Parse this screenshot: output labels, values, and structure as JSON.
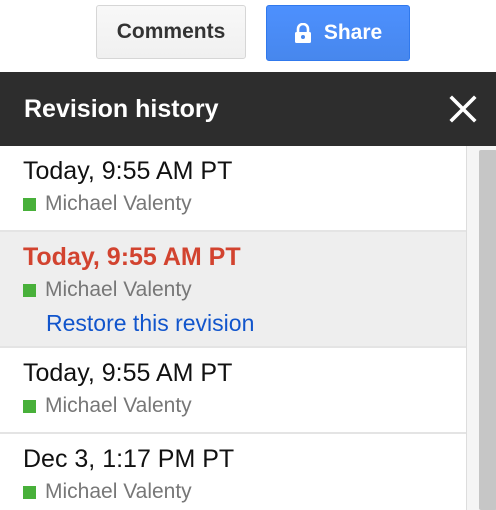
{
  "toolbar": {
    "comments_label": "Comments",
    "share_label": "Share"
  },
  "panel": {
    "title": "Revision history"
  },
  "revisions": [
    {
      "date": "Today, 9:55 AM PT",
      "author": "Michael Valenty",
      "author_color": "#48b03a",
      "selected": false
    },
    {
      "date": "Today, 9:55 AM PT",
      "author": "Michael Valenty",
      "author_color": "#48b03a",
      "selected": true,
      "action_label": "Restore this revision"
    },
    {
      "date": "Today, 9:55 AM PT",
      "author": "Michael Valenty",
      "author_color": "#48b03a",
      "selected": false
    },
    {
      "date": "Dec 3, 1:17 PM PT",
      "author": "Michael Valenty",
      "author_color": "#48b03a",
      "selected": false
    }
  ],
  "colors": {
    "share_button": "#4d90fe",
    "header_bg": "#2d2d2d",
    "selected_date": "#d2432f",
    "link": "#1155cc"
  },
  "icons": {
    "share": "lock-icon",
    "close": "close-icon",
    "author_marker": "color-swatch"
  }
}
